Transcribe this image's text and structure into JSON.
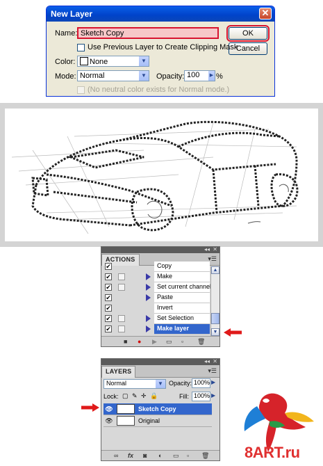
{
  "dialog": {
    "title": "New Layer",
    "close_glyph": "✕",
    "name_label": "Name:",
    "name_value": "Sketch Copy",
    "ok_label": "OK",
    "cancel_label": "Cancel",
    "clip_label": "Use Previous Layer to Create Clipping Mask",
    "color_label": "Color:",
    "color_value": "None",
    "mode_label": "Mode:",
    "mode_value": "Normal",
    "opacity_label": "Opacity:",
    "opacity_value": "100",
    "opacity_unit": "%",
    "neutral_label": "(No neutral color exists for Normal mode.)"
  },
  "actions": {
    "tab": "ACTIONS",
    "items": [
      {
        "label": "Copy",
        "checked": true,
        "expand": false
      },
      {
        "label": "Make",
        "checked": true,
        "expand": true
      },
      {
        "label": "Set current channel",
        "checked": true,
        "expand": true
      },
      {
        "label": "Paste",
        "checked": true,
        "expand": true
      },
      {
        "label": "Invert",
        "checked": true,
        "expand": false
      },
      {
        "label": "Set Selection",
        "checked": true,
        "expand": true
      },
      {
        "label": "Make layer",
        "checked": true,
        "expand": true,
        "selected": true
      }
    ]
  },
  "layers": {
    "tab": "LAYERS",
    "blend_mode": "Normal",
    "opacity_label": "Opacity:",
    "opacity_value": "100%",
    "lock_label": "Lock:",
    "fill_label": "Fill:",
    "fill_value": "100%",
    "items": [
      {
        "name": "Sketch Copy",
        "selected": true
      },
      {
        "name": "Original",
        "selected": false
      }
    ]
  },
  "logo": {
    "text": "8ART.ru"
  },
  "colors": {
    "accent_red": "#d8132f",
    "selection_blue": "#3366cc",
    "xp_title": "#0043c9"
  }
}
